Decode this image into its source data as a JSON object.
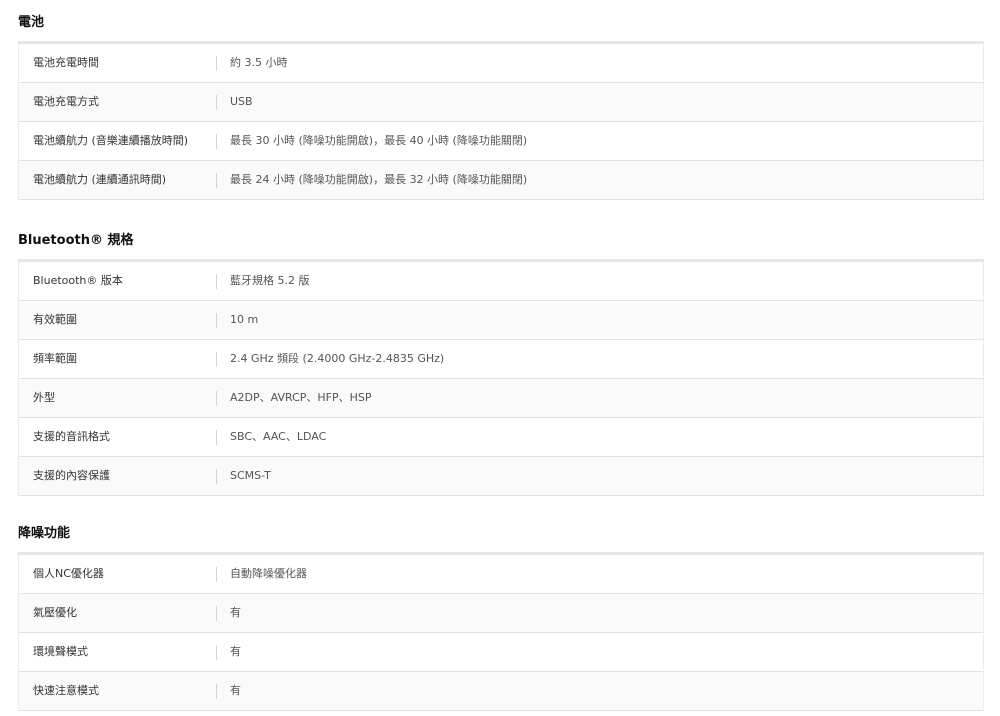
{
  "sections": [
    {
      "title": "電池",
      "rows": [
        {
          "label": "電池充電時間",
          "value": "約 3.5 小時"
        },
        {
          "label": "電池充電方式",
          "value": "USB"
        },
        {
          "label": "電池續航力 (音樂連續播放時間)",
          "value": "最長 30 小時 (降噪功能開啟)，最長 40 小時 (降噪功能關閉)"
        },
        {
          "label": "電池續航力 (連續通訊時間)",
          "value": "最長 24 小時 (降噪功能開啟)，最長 32 小時 (降噪功能關閉)"
        }
      ]
    },
    {
      "title": "Bluetooth® 規格",
      "rows": [
        {
          "label": "Bluetooth® 版本",
          "value": "藍牙規格 5.2 版"
        },
        {
          "label": "有效範圍",
          "value": "10 m"
        },
        {
          "label": "頻率範圍",
          "value": "2.4 GHz 頻段 (2.4000 GHz-2.4835 GHz)"
        },
        {
          "label": "外型",
          "value": "A2DP、AVRCP、HFP、HSP"
        },
        {
          "label": "支援的音訊格式",
          "value": "SBC、AAC、LDAC"
        },
        {
          "label": "支援的內容保護",
          "value": "SCMS-T"
        }
      ]
    },
    {
      "title": "降噪功能",
      "rows": [
        {
          "label": "個人NC優化器",
          "value": "自動降噪優化器"
        },
        {
          "label": "氣壓優化",
          "value": "有"
        },
        {
          "label": "環境聲模式",
          "value": "有"
        },
        {
          "label": "快速注意模式",
          "value": "有"
        }
      ]
    }
  ]
}
